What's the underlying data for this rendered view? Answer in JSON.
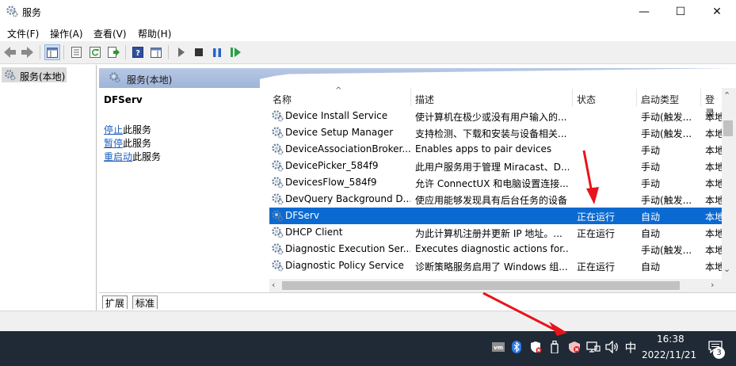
{
  "window": {
    "title": "服务",
    "minimize": "—",
    "maximize": "☐",
    "close": "✕"
  },
  "menu": [
    "文件(F)",
    "操作(A)",
    "查看(V)",
    "帮助(H)"
  ],
  "toolbar_icons": [
    "back-icon",
    "forward-icon",
    "show-hide-console-tree-icon",
    "properties-icon",
    "refresh-icon",
    "export-list-icon",
    "help-icon",
    "show-hide-action-pane-icon",
    "start-service-icon",
    "stop-service-icon",
    "pause-service-icon",
    "resume-service-icon"
  ],
  "tree": {
    "node_label": "服务(本地)"
  },
  "panel": {
    "header": "服务(本地)",
    "selected_service": "DFServ"
  },
  "actions": [
    {
      "link": "停止",
      "suffix": "此服务"
    },
    {
      "link": "暂停",
      "suffix": "此服务"
    },
    {
      "link": "重启动",
      "suffix": "此服务"
    }
  ],
  "columns": [
    "名称",
    "描述",
    "状态",
    "启动类型",
    "登录"
  ],
  "rows": [
    {
      "name": "Device Install Service",
      "desc": "使计算机在极少或没有用户输入的...",
      "status": "",
      "startup": "手动(触发...",
      "logon": "本地"
    },
    {
      "name": "Device Setup Manager",
      "desc": "支持检测、下载和安装与设备相关...",
      "status": "",
      "startup": "手动(触发...",
      "logon": "本地"
    },
    {
      "name": "DeviceAssociationBroker...",
      "desc": "Enables apps to pair devices",
      "status": "",
      "startup": "手动",
      "logon": "本地"
    },
    {
      "name": "DevicePicker_584f9",
      "desc": "此用户服务用于管理 Miracast、D...",
      "status": "",
      "startup": "手动",
      "logon": "本地"
    },
    {
      "name": "DevicesFlow_584f9",
      "desc": "允许 ConnectUX 和电脑设置连接...",
      "status": "",
      "startup": "手动",
      "logon": "本地"
    },
    {
      "name": "DevQuery Background D...",
      "desc": "使应用能够发现具有后台任务的设备",
      "status": "",
      "startup": "手动(触发...",
      "logon": "本地"
    },
    {
      "name": "DFServ",
      "desc": "",
      "status": "正在运行",
      "startup": "自动",
      "logon": "本地"
    },
    {
      "name": "DHCP Client",
      "desc": "为此计算机注册并更新 IP 地址。...",
      "status": "正在运行",
      "startup": "自动",
      "logon": "本地"
    },
    {
      "name": "Diagnostic Execution Ser...",
      "desc": "Executes diagnostic actions for...",
      "status": "",
      "startup": "手动(触发...",
      "logon": "本地"
    },
    {
      "name": "Diagnostic Policy Service",
      "desc": "诊断策略服务启用了 Windows 组...",
      "status": "正在运行",
      "startup": "自动",
      "logon": "本地"
    }
  ],
  "selected_row_index": 6,
  "tabs": [
    "扩展",
    "标准"
  ],
  "taskbar": {
    "ime": "中",
    "time": "16:38",
    "date": "2022/11/21",
    "notification_count": "3",
    "tray_icons": [
      "vmware-icon",
      "bluetooth-icon",
      "security-warning-icon",
      "usb-drive-icon",
      "security-center-icon",
      "network-icon",
      "volume-icon",
      "ime-icon",
      "notification-icon"
    ]
  },
  "colors": {
    "selection": "#0a6ad2",
    "annotation_arrow": "#e8141b",
    "taskbar": "#1f2a36",
    "panel_header": "#a9bddf"
  }
}
